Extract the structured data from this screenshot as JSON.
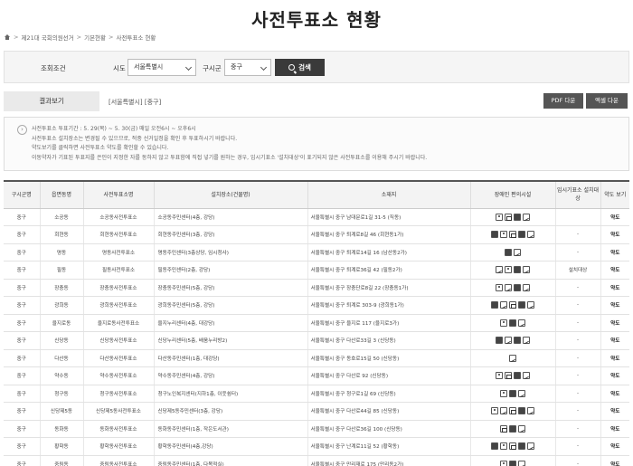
{
  "page": {
    "title": "사전투표소 현황",
    "breadcrumb": [
      "제21대 국회의원선거",
      "기본현황",
      "사전투표소 현황"
    ]
  },
  "search": {
    "condition_label": "조회조건",
    "sido_label": "시도",
    "sido_value": "서울특별시",
    "gu_label": "구시군",
    "gu_value": "중구",
    "button_label": "검색"
  },
  "result": {
    "tab_label": "결과보기",
    "region_text": "[서울특별시] [중구]",
    "pdf_label": "PDF 다운",
    "excel_label": "엑셀 다운"
  },
  "notice": {
    "lines": [
      "사전투표소 투표기간 : 5. 29(목) ~ 5. 30(금) 매일 오전6시 ~ 오후6시",
      "사전투표소 설치장소는 변경될 수 있으므로, 적중 선거일정을 확인 후 투표하시기 바랍니다.",
      "약도보기를 클릭하면 사전투표소 약도를 확인할 수 있습니다.",
      "이동약자가 기표된 투표지를 은인이 지정한 자를 동하지 않고 투표함에 직접 넣기를 원하는 경우, 임시기표소 '설치대상'이 표기되지 않은 사전투표소를 이용해 주시기 바랍니다."
    ]
  },
  "table": {
    "headers": [
      "구시군명",
      "읍면동명",
      "사전투표소명",
      "설치장소(건물명)",
      "소재지",
      "장애인 편의시설",
      "임시기표소 설치대상",
      "약도 보기"
    ],
    "rows": [
      {
        "gu": "중구",
        "dong": "소공동",
        "name": "소공동사전투표소",
        "place": "소공동주민센터(4층, 강당)",
        "addr": "서울특별시 중구 남대문로1길 31-5 (직동)",
        "temp": "",
        "map": "약도"
      },
      {
        "gu": "중구",
        "dong": "회현동",
        "name": "회현동사전투표소",
        "place": "회현동주민센터(3층, 강당)",
        "addr": "서울특별시 중구 퇴계로8길 46 (회현동1가)",
        "temp": "-",
        "map": "약도"
      },
      {
        "gu": "중구",
        "dong": "명동",
        "name": "명동사전투표소",
        "place": "명동주민센터(3층상당, 임시청사)",
        "addr": "서울특별시 중구 퇴계로14길 16 (남산동2가)",
        "temp": "-",
        "map": "약도"
      },
      {
        "gu": "중구",
        "dong": "필동",
        "name": "필동사전투표소",
        "place": "필동주민센터(2층, 강당)",
        "addr": "서울특별시 중구 퇴계로36길 42 (필동2가)",
        "temp": "설치대상",
        "map": "약도"
      },
      {
        "gu": "중구",
        "dong": "장충동",
        "name": "장충동사전투표소",
        "place": "장충동주민센터(5층, 강당)",
        "addr": "서울특별시 중구 장충단로8길 22 (장충동1가)",
        "temp": "-",
        "map": "약도"
      },
      {
        "gu": "중구",
        "dong": "광희동",
        "name": "광희동사전투표소",
        "place": "광희동주민센터(5층, 강당)",
        "addr": "서울특별시 중구 퇴계로 303-9 (광희동1가)",
        "temp": "-",
        "map": "약도"
      },
      {
        "gu": "중구",
        "dong": "을지로동",
        "name": "을지로동사전투표소",
        "place": "을지누리센터(4층, 대강당)",
        "addr": "서울특별시 중구 을지로 117 (을지로3가)",
        "temp": "-",
        "map": "약도"
      },
      {
        "gu": "중구",
        "dong": "신당동",
        "name": "신당동사전투표소",
        "place": "신당누리센터(5층, 배움누리방2)",
        "addr": "서울특별시 중구 다산로33길 3 (신당동)",
        "temp": "-",
        "map": "약도"
      },
      {
        "gu": "중구",
        "dong": "다산동",
        "name": "다산동사전투표소",
        "place": "다산동주민센터(1층, 대강당)",
        "addr": "서울특별시 중구 동호로15길 50 (신당동)",
        "temp": "-",
        "map": "약도"
      },
      {
        "gu": "중구",
        "dong": "약수동",
        "name": "약수동사전투표소",
        "place": "약수동주민센터(4층, 강당)",
        "addr": "서울특별시 중구 다산로 92 (신당동)",
        "temp": "-",
        "map": "약도"
      },
      {
        "gu": "중구",
        "dong": "청구동",
        "name": "청구동사전투표소",
        "place": "청구노인복지센터(지하1층, 이웃쉼터)",
        "addr": "서울특별시 중구 청구로1길 69 (신당동)",
        "temp": "-",
        "map": "약도"
      },
      {
        "gu": "중구",
        "dong": "신당제5동",
        "name": "신당제5동사전투표소",
        "place": "신당제5동주민센터(3층, 강당)",
        "addr": "서울특별시 중구 다산로44길 85 (신당동)",
        "temp": "-",
        "map": "약도"
      },
      {
        "gu": "중구",
        "dong": "동화동",
        "name": "동화동사전투표소",
        "place": "동화동주민센터(1층, 작은도서관)",
        "addr": "서울특별시 중구 다산로36길 100 (신당동)",
        "temp": "-",
        "map": "약도"
      },
      {
        "gu": "중구",
        "dong": "황학동",
        "name": "황학동사전투표소",
        "place": "황학동주민센터(4층,강당)",
        "addr": "서울특별시 중구 난계로11길 52 (황학동)",
        "temp": "-",
        "map": "약도"
      },
      {
        "gu": "중구",
        "dong": "중림동",
        "name": "중림동사전투표소",
        "place": "중림동주민센터(1층, 다목적실)",
        "addr": "서울특별시 중구 만리재로 175 (만리동2가)",
        "temp": "-",
        "map": "약도"
      }
    ]
  }
}
